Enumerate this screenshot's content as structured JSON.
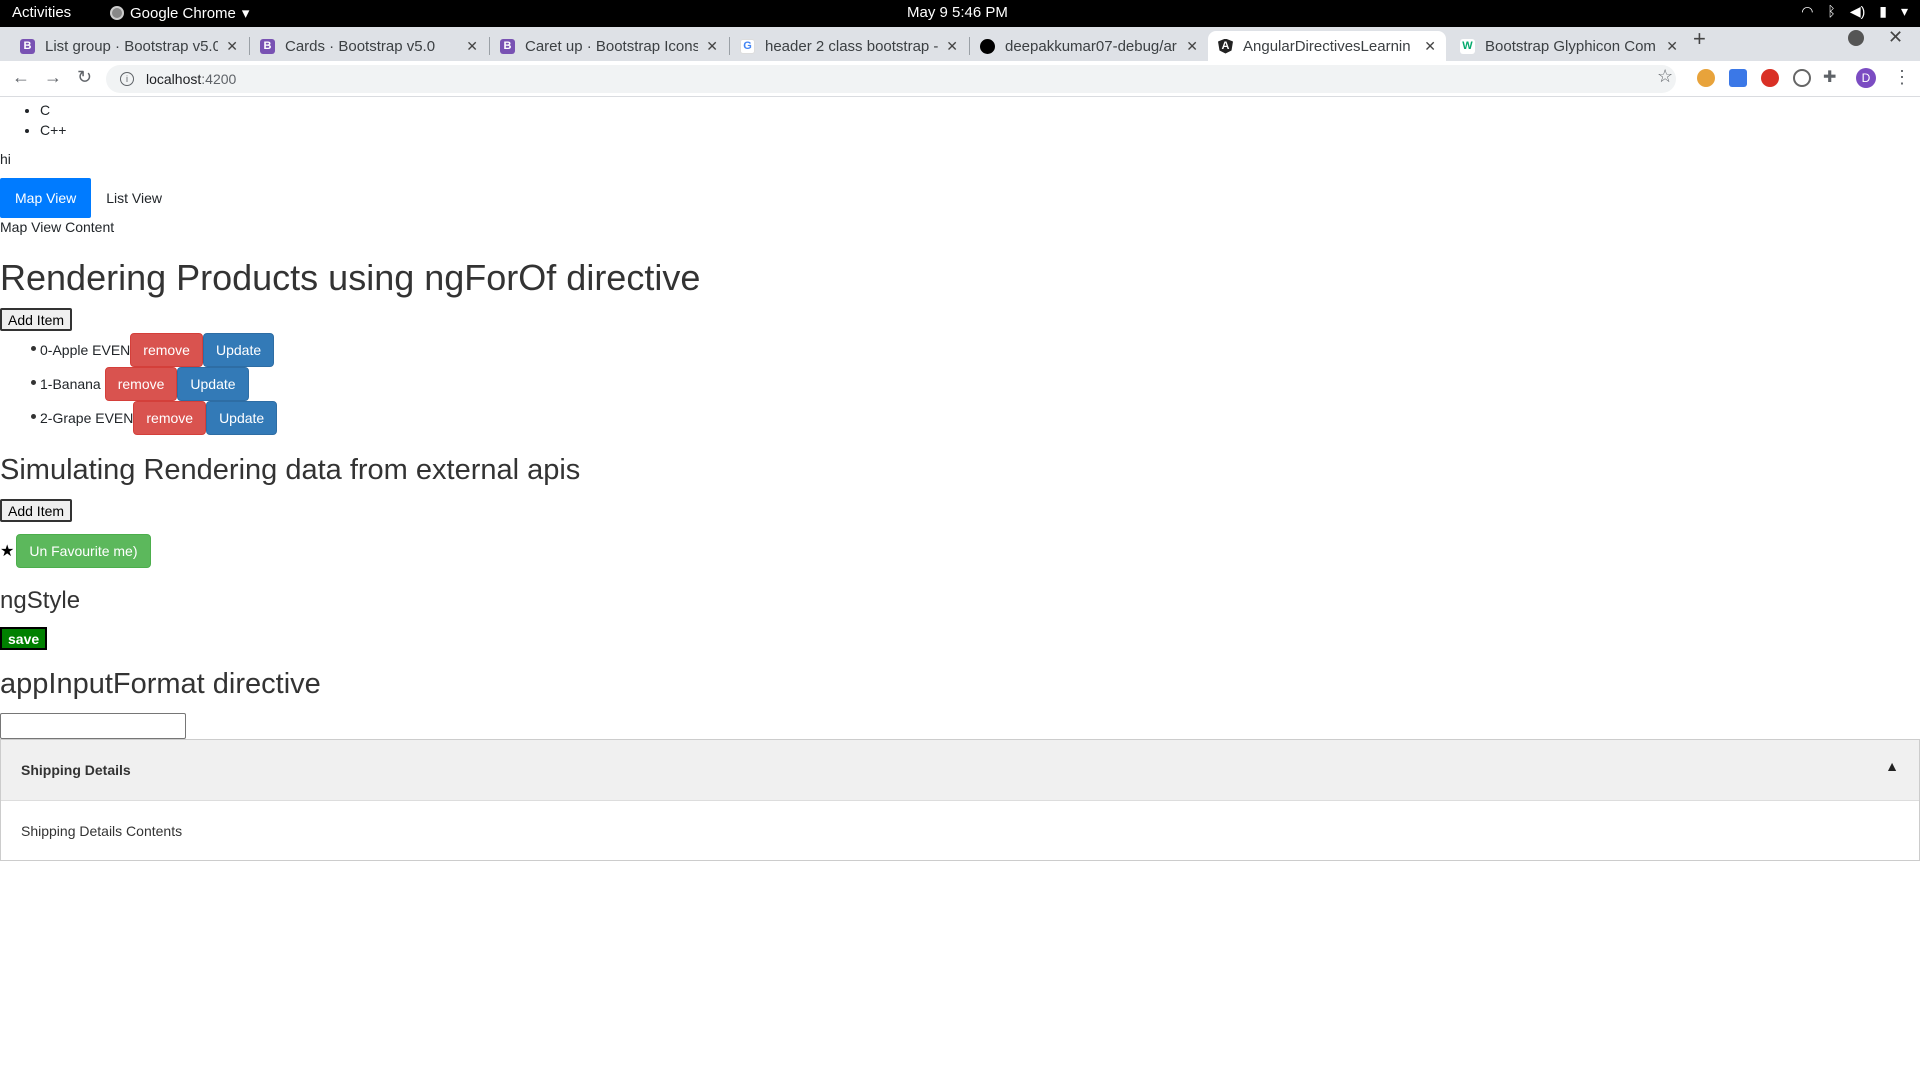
{
  "gnome": {
    "activities": "Activities",
    "app_name": "Google Chrome",
    "clock": "May 9  5:46 PM"
  },
  "browser": {
    "tabs": [
      {
        "title": "List group · Bootstrap v5.0",
        "icon": "bootstrap-icon",
        "color": "#7952b3"
      },
      {
        "title": "Cards · Bootstrap v5.0",
        "icon": "bootstrap-icon",
        "color": "#7952b3"
      },
      {
        "title": "Caret up · Bootstrap Icons",
        "icon": "bootstrap-icon",
        "color": "#7952b3"
      },
      {
        "title": "header 2 class bootstrap -",
        "icon": "google-icon",
        "color": "#4285f4"
      },
      {
        "title": "deepakkumar07-debug/ar",
        "icon": "github-icon",
        "color": "#000000"
      },
      {
        "title": "AngularDirectivesLearnin",
        "icon": "angular-icon",
        "color": "#222222"
      },
      {
        "title": "Bootstrap Glyphicon Com",
        "icon": "w3-icon",
        "color": "#04aa6d"
      }
    ],
    "active_tab": 5,
    "url_host": "localhost",
    "url_port": ":4200",
    "profile_initial": "D"
  },
  "page": {
    "languages": [
      "C",
      "C++"
    ],
    "hi_text": "hi",
    "view_tabs": {
      "map": "Map View",
      "list": "List View"
    },
    "map_view_content": "Map View Content",
    "products_heading": "Rendering Products using ngForOf directive",
    "add_item_label": "Add Item",
    "products": [
      {
        "label": "0-Apple EVEN"
      },
      {
        "label": "1-Banana"
      },
      {
        "label": "2-Grape EVEN"
      }
    ],
    "remove_label": "remove",
    "update_label": "Update",
    "external_heading": "Simulating Rendering data from external apis",
    "add_item_label_2": "Add Item",
    "favourite_star": "★",
    "unfavourite_label": "Un Favourite me)",
    "ngstyle_heading": "ngStyle",
    "save_label": "save",
    "input_format_heading": "appInputFormat directive",
    "input_value": "",
    "accordion": {
      "title": "Shipping Details",
      "body": "Shipping Details Contents"
    }
  },
  "colors": {
    "primary": "#007bff",
    "danger": "#d9534f",
    "info": "#337ab7",
    "success": "#5cb85c",
    "save_green": "#008000"
  }
}
